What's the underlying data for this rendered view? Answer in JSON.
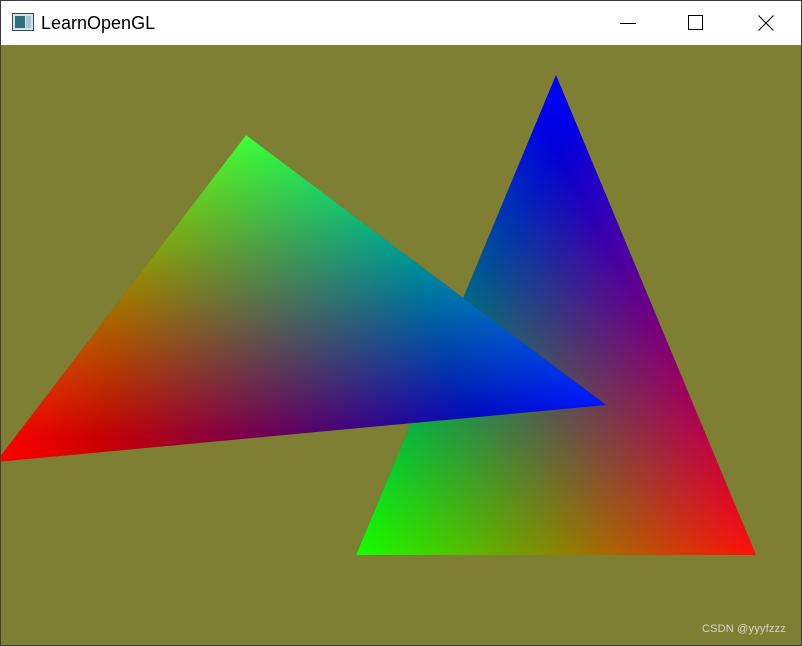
{
  "window": {
    "title": "LearnOpenGL",
    "controls": {
      "minimize_icon": "minimize-icon",
      "maximize_icon": "maximize-icon",
      "close_icon": "close-icon"
    }
  },
  "viewport": {
    "clear_color": "#7f7f33",
    "watermark": "CSDN @yyyfzzz"
  },
  "scene": {
    "triangle_back": {
      "vertex_colors": [
        "#ff0000",
        "#00ff00",
        "#0000ff"
      ]
    },
    "triangle_front": {
      "vertex_colors": [
        "#ff0000",
        "#00ff00",
        "#0000ff"
      ]
    }
  }
}
